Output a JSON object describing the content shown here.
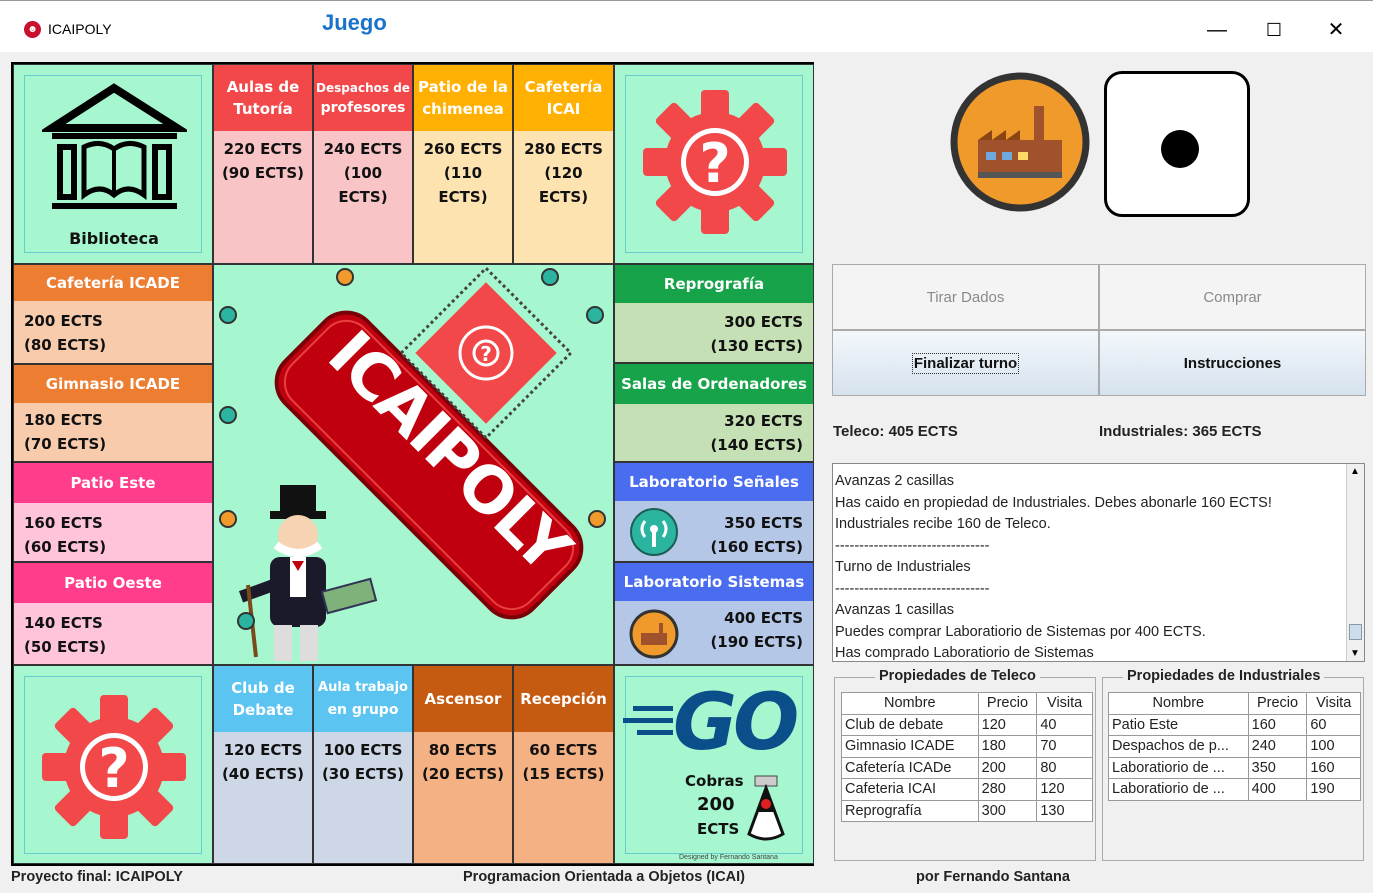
{
  "window": {
    "app_title": "ICAIPOLY",
    "heading": "Juego",
    "minimize": "—",
    "maximize": "☐",
    "close": "✕"
  },
  "colors": {
    "board_bg": "#a6f7cf",
    "red": "#f2484a",
    "dark_red": "#e02020",
    "pink_light": "#f8c4c6",
    "orange": "#ffb000",
    "yellow_light": "#fde3b0",
    "brown": "#ed7d31",
    "brown_light": "#f8cbad",
    "magenta": "#ff3d8a",
    "pink2": "#ffc4dc",
    "green": "#16a34a",
    "green_light": "#c5e0b4",
    "blue": "#4a6df0",
    "blue_light": "#b4c7e7",
    "cyan": "#5bc4f0",
    "grey_blue": "#cdd7e6",
    "orange2": "#c55a11",
    "peach": "#f4b183"
  },
  "board": {
    "biblioteca": "Biblioteca",
    "top": [
      {
        "name1": "Aulas de",
        "name2": "Tutoría",
        "price1": "220 ECTS",
        "price2": "(90 ECTS)",
        "price3": ""
      },
      {
        "name1": "Despachos de",
        "name2": "profesores",
        "price1": "240 ECTS",
        "price2": "(100",
        "price3": "ECTS)"
      },
      {
        "name1": "Patio de la",
        "name2": "chimenea",
        "price1": "260 ECTS",
        "price2": "(110",
        "price3": "ECTS)"
      },
      {
        "name1": "Cafetería",
        "name2": "ICAI",
        "price1": "280 ECTS",
        "price2": "(120",
        "price3": "ECTS)"
      }
    ],
    "left": [
      {
        "name": "Cafetería ICADE",
        "price1": "200 ECTS",
        "price2": "(80 ECTS)"
      },
      {
        "name": "Gimnasio ICADE",
        "price1": "180 ECTS",
        "price2": "(70 ECTS)"
      },
      {
        "name": "Patio Este",
        "price1": "160 ECTS",
        "price2": "(60 ECTS)"
      },
      {
        "name": "Patio Oeste",
        "price1": "140 ECTS",
        "price2": "(50 ECTS)"
      }
    ],
    "right": [
      {
        "name": "Reprografía",
        "price1": "300 ECTS",
        "price2": "(130 ECTS)"
      },
      {
        "name": "Salas de Ordenadores",
        "price1": "320 ECTS",
        "price2": "(140 ECTS)"
      },
      {
        "name": "Laboratorio Señales",
        "price1": "350 ECTS",
        "price2": "(160 ECTS)"
      },
      {
        "name": "Laboratorio Sistemas",
        "price1": "400 ECTS",
        "price2": "(190 ECTS)"
      }
    ],
    "bottom": [
      {
        "name1": "Club de",
        "name2": "Debate",
        "price1": "120 ECTS",
        "price2": "(40 ECTS)"
      },
      {
        "name1": "Aula trabajo",
        "name2": "en grupo",
        "price1": "100 ECTS",
        "price2": "(30 ECTS)"
      },
      {
        "name1": "Ascensor",
        "name2": "",
        "price1": "80 ECTS",
        "price2": "(20 ECTS)"
      },
      {
        "name1": "Recepción",
        "name2": "",
        "price1": "60 ECTS",
        "price2": "(15 ECTS)"
      }
    ],
    "center_logo": "ICAIPOLY",
    "go_text": "GO",
    "go_cobras": "Cobras",
    "go_amount": "200",
    "go_unit": "ECTS",
    "designed_by": "Designed by Fernando Santana"
  },
  "controls": {
    "roll": "Tirar Dados",
    "buy": "Comprar",
    "end_turn": "Finalizar turno",
    "instructions": "Instrucciones"
  },
  "scores": {
    "teleco": "Teleco: 405 ECTS",
    "industriales": "Industriales: 365 ECTS"
  },
  "log": [
    "Avanzas 2 casillas",
    "Has caido en propiedad de Industriales. Debes abonarle 160 ECTS!",
    "Industriales recibe 160 de Teleco.",
    "--------------------------------",
    "Turno de Industriales",
    "--------------------------------",
    "Avanzas 1 casillas",
    "Puedes comprar Laboratiorio de Sistemas por 400 ECTS.",
    "Has comprado Laboratiorio de Sistemas"
  ],
  "teleco_props": {
    "title": "Propiedades de Teleco",
    "headers": [
      "Nombre",
      "Precio",
      "Visita"
    ],
    "rows": [
      [
        "Club de debate",
        "120",
        "40"
      ],
      [
        "Gimnasio ICADE",
        "180",
        "70"
      ],
      [
        "Cafetería ICADe",
        "200",
        "80"
      ],
      [
        "Cafeteria ICAI",
        "280",
        "120"
      ],
      [
        "Reprografía",
        "300",
        "130"
      ]
    ]
  },
  "ind_props": {
    "title": "Propiedades de Industriales",
    "headers": [
      "Nombre",
      "Precio",
      "Visita"
    ],
    "rows": [
      [
        "Patio Este",
        "160",
        "60"
      ],
      [
        "Despachos de p...",
        "240",
        "100"
      ],
      [
        "Laboratiorio de ...",
        "350",
        "160"
      ],
      [
        "Laboratiorio de ...",
        "400",
        "190"
      ]
    ]
  },
  "footer": {
    "left": "Proyecto final: ICAIPOLY",
    "center": "Programacion Orientada a Objetos (ICAI)",
    "right": "por Fernando Santana"
  }
}
